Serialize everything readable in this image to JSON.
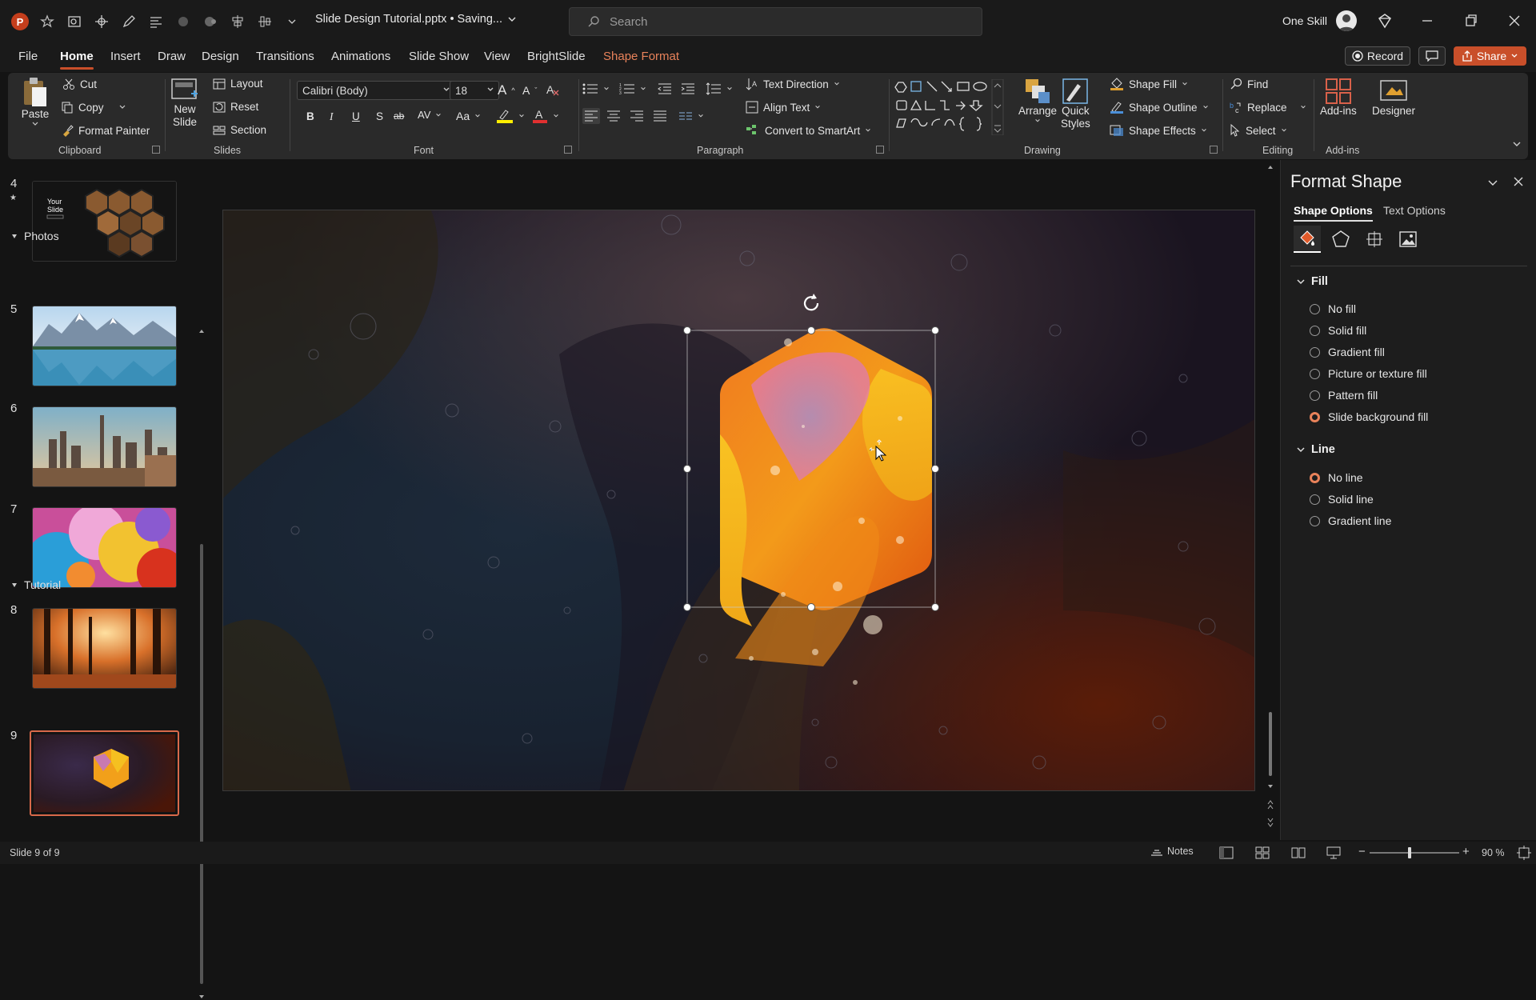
{
  "titlebar": {
    "doc_title": "Slide Design Tutorial.pptx • Saving...",
    "search_placeholder": "Search",
    "account_name": "One Skill"
  },
  "menu": {
    "tabs": [
      "File",
      "Home",
      "Insert",
      "Draw",
      "Design",
      "Transitions",
      "Animations",
      "Slide Show",
      "View",
      "BrightSlide",
      "Shape Format"
    ],
    "active": "Home",
    "record": "Record",
    "share": "Share"
  },
  "ribbon": {
    "clipboard": {
      "paste": "Paste",
      "cut": "Cut",
      "copy": "Copy",
      "format_painter": "Format Painter",
      "label": "Clipboard"
    },
    "slides": {
      "new_slide_1": "New",
      "new_slide_2": "Slide",
      "layout": "Layout",
      "reset": "Reset",
      "section": "Section",
      "label": "Slides"
    },
    "font": {
      "family": "Calibri (Body)",
      "size": "18",
      "bold": "B",
      "italic": "I",
      "underline": "U",
      "shadow": "S",
      "strike": "ab",
      "spacing": "AV",
      "case": "Aa",
      "grow": "A",
      "shrink": "A",
      "label": "Font"
    },
    "paragraph": {
      "text_direction": "Text Direction",
      "align_text": "Align Text",
      "smartart": "Convert to SmartArt",
      "label": "Paragraph"
    },
    "drawing": {
      "arrange": "Arrange",
      "quick_styles_1": "Quick",
      "quick_styles_2": "Styles",
      "shape_fill": "Shape Fill",
      "shape_outline": "Shape Outline",
      "shape_effects": "Shape Effects",
      "label": "Drawing"
    },
    "editing": {
      "find": "Find",
      "replace": "Replace",
      "select": "Select",
      "label": "Editing"
    },
    "addins": {
      "addins": "Add-ins",
      "designer": "Designer",
      "label": "Add-ins"
    }
  },
  "thumbnails": {
    "sections": {
      "photos": "Photos",
      "tutorial": "Tutorial"
    },
    "slide_numbers": [
      "4",
      "5",
      "6",
      "7",
      "8",
      "9"
    ],
    "slide4_text": "Your Slide"
  },
  "format_pane": {
    "title": "Format Shape",
    "tabs": [
      "Shape Options",
      "Text Options"
    ],
    "fill": {
      "label": "Fill",
      "options": [
        "No fill",
        "Solid fill",
        "Gradient fill",
        "Picture or texture fill",
        "Pattern fill",
        "Slide background fill"
      ],
      "selected": "Slide background fill"
    },
    "line": {
      "label": "Line",
      "options": [
        "No line",
        "Solid line",
        "Gradient line"
      ],
      "selected": "No line"
    }
  },
  "status": {
    "slide_info": "Slide 9 of 9",
    "notes": "Notes",
    "zoom": "90 %"
  },
  "colors": {
    "accent": "#c94f2a",
    "contextual_tab": "#e8825a"
  }
}
